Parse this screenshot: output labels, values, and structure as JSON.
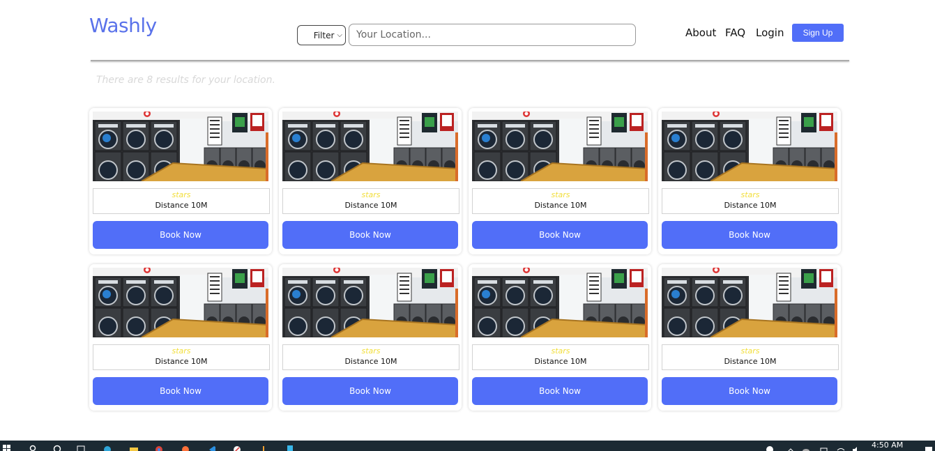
{
  "header": {
    "logo": "Washly",
    "filter_label": "Filter",
    "location_placeholder": "Your Location...",
    "nav": {
      "about": "About",
      "faq": "FAQ",
      "login": "Login",
      "signup": "Sign Up"
    }
  },
  "results": {
    "text": "There are 8 results for your location."
  },
  "cards": [
    {
      "stars": "stars",
      "distance": "Distance 10M",
      "button": "Book Now"
    },
    {
      "stars": "stars",
      "distance": "Distance 10M",
      "button": "Book Now"
    },
    {
      "stars": "stars",
      "distance": "Distance 10M",
      "button": "Book Now"
    },
    {
      "stars": "stars",
      "distance": "Distance 10M",
      "button": "Book Now"
    },
    {
      "stars": "stars",
      "distance": "Distance 10M",
      "button": "Book Now"
    },
    {
      "stars": "stars",
      "distance": "Distance 10M",
      "button": "Book Now"
    },
    {
      "stars": "stars",
      "distance": "Distance 10M",
      "button": "Book Now"
    },
    {
      "stars": "stars",
      "distance": "Distance 10M",
      "button": "Book Now"
    }
  ],
  "taskbar": {
    "time": "4:50 AM"
  },
  "colors": {
    "accent": "#516ef8",
    "logo": "#5a72ea",
    "stars": "#f2de3a"
  }
}
